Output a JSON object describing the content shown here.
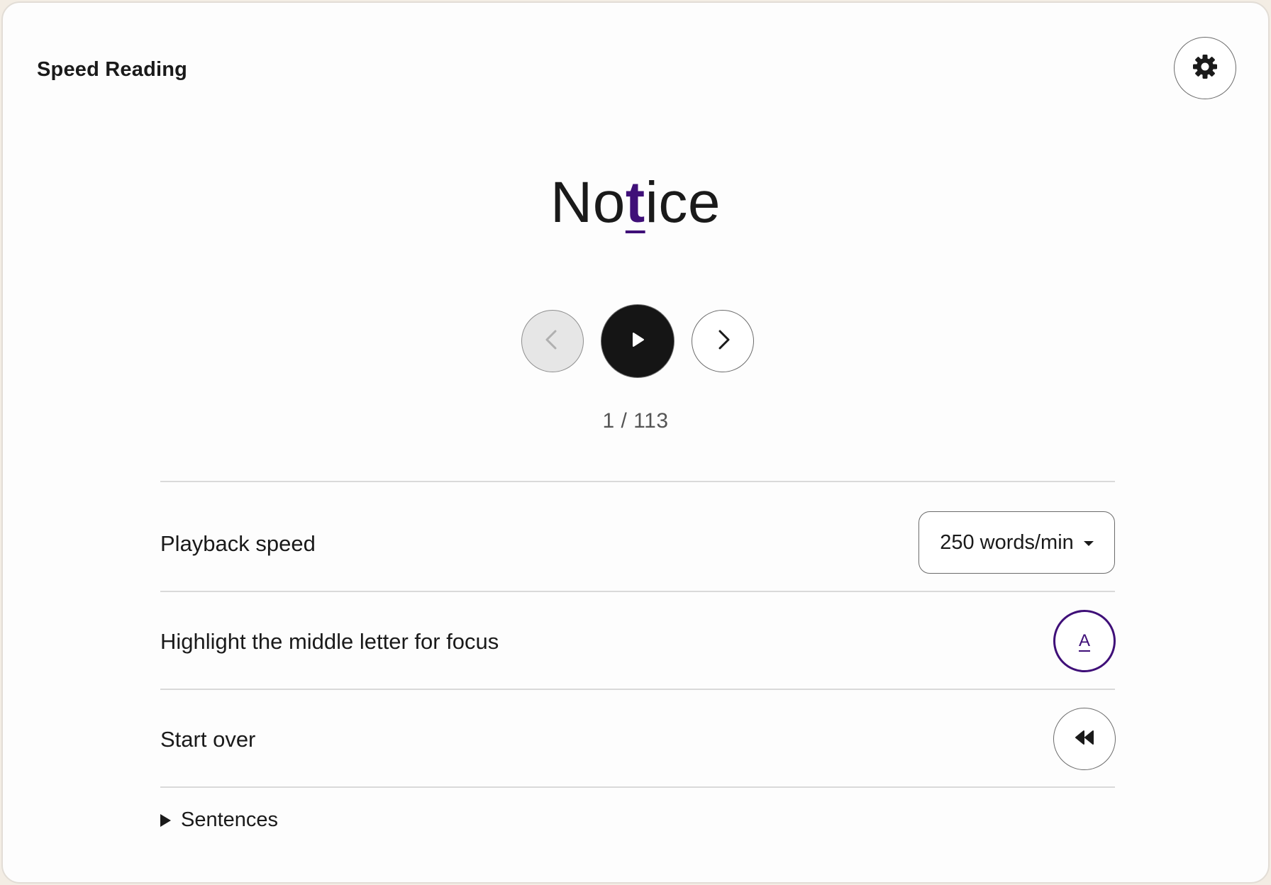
{
  "app": {
    "title": "Speed Reading"
  },
  "icons": {
    "settings": "gear-icon",
    "previous": "chevron-left-icon",
    "play": "play-icon",
    "next": "chevron-right-icon",
    "highlight": "underlined-a-icon",
    "restart": "rewind-icon",
    "sentences": "disclosure-triangle-icon"
  },
  "reader": {
    "word_before": "No",
    "focus_letter": "t",
    "word_after": "ice",
    "position": "1 / 113",
    "current_index": 1,
    "total_words": 113
  },
  "settings": {
    "playback_speed_label": "Playback speed",
    "playback_speed_value": "250 words/min",
    "highlight_label": "Highlight the middle letter for focus",
    "highlight_glyph": "A",
    "highlight_enabled": true,
    "start_over_label": "Start over"
  },
  "sentences": {
    "label": "Sentences",
    "expanded": false
  },
  "colors": {
    "accent": "#3f0f78",
    "play_button": "#151515",
    "disabled_button": "#e6e6e6",
    "page_background": "#f3ede4"
  }
}
